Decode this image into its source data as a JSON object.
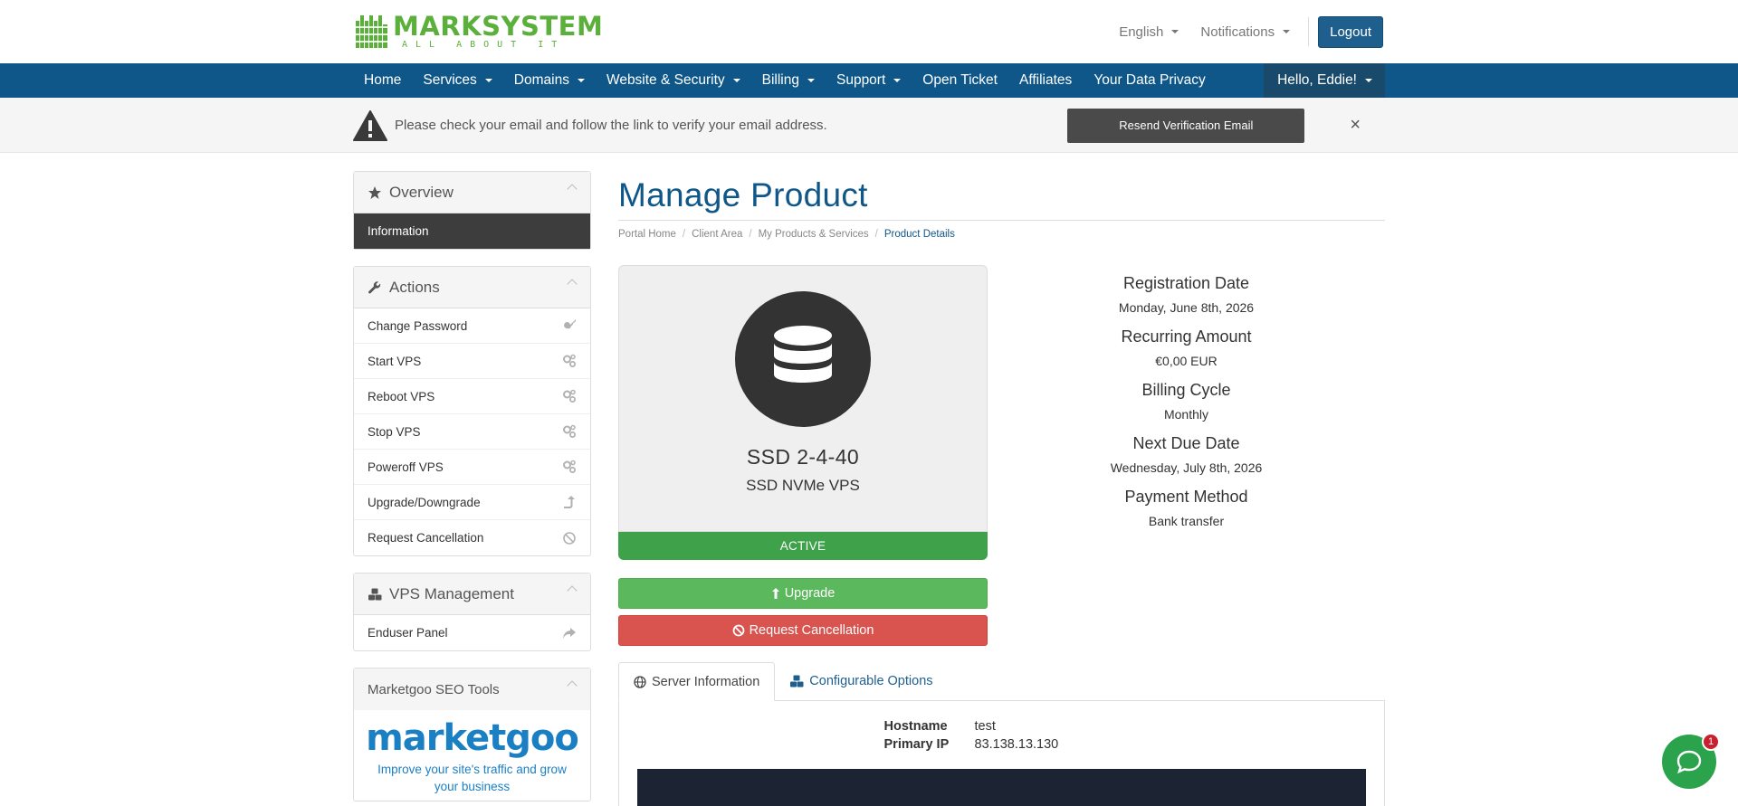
{
  "brand": {
    "name": "MARKSYSTEM",
    "tagline": "ALL ABOUT IT",
    "color": "#5bb03c"
  },
  "header": {
    "language": "English",
    "notifications": "Notifications",
    "logout": "Logout"
  },
  "nav": {
    "items": [
      {
        "label": "Home",
        "dropdown": false
      },
      {
        "label": "Services",
        "dropdown": true
      },
      {
        "label": "Domains",
        "dropdown": true
      },
      {
        "label": "Website & Security",
        "dropdown": true
      },
      {
        "label": "Billing",
        "dropdown": true
      },
      {
        "label": "Support",
        "dropdown": true
      },
      {
        "label": "Open Ticket",
        "dropdown": false
      },
      {
        "label": "Affiliates",
        "dropdown": false
      },
      {
        "label": "Your Data Privacy",
        "dropdown": false
      }
    ],
    "user": "Hello, Eddie!"
  },
  "alert": {
    "message": "Please check your email and follow the link to verify your email address.",
    "button": "Resend Verification Email",
    "close": "×"
  },
  "sidebar": {
    "overview": {
      "title": "Overview",
      "items": [
        {
          "label": "Information"
        }
      ]
    },
    "actions": {
      "title": "Actions",
      "items": [
        {
          "label": "Change Password",
          "icon": "key-icon"
        },
        {
          "label": "Start VPS",
          "icon": "cogs-icon"
        },
        {
          "label": "Reboot VPS",
          "icon": "cogs-icon"
        },
        {
          "label": "Stop VPS",
          "icon": "cogs-icon"
        },
        {
          "label": "Poweroff VPS",
          "icon": "cogs-icon"
        },
        {
          "label": "Upgrade/Downgrade",
          "icon": "level-up-icon"
        },
        {
          "label": "Request Cancellation",
          "icon": "ban-icon"
        }
      ]
    },
    "vps": {
      "title": "VPS Management",
      "items": [
        {
          "label": "Enduser Panel",
          "icon": "share-icon"
        }
      ]
    },
    "seo": {
      "title": "Marketgoo SEO Tools",
      "logo": "marketgoo",
      "text": "Improve your site's traffic and grow your business"
    }
  },
  "main": {
    "title": "Manage Product",
    "breadcrumb": [
      "Portal Home",
      "Client Area",
      "My Products & Services",
      "Product Details"
    ],
    "product": {
      "name": "SSD 2-4-40",
      "group": "SSD NVMe VPS",
      "status": "ACTIVE"
    },
    "buttons": {
      "upgrade": "Upgrade",
      "cancel": "Request Cancellation"
    },
    "info": [
      {
        "label": "Registration Date",
        "value": "Monday, June 8th, 2026"
      },
      {
        "label": "Recurring Amount",
        "value": "€0,00 EUR"
      },
      {
        "label": "Billing Cycle",
        "value": "Monthly"
      },
      {
        "label": "Next Due Date",
        "value": "Wednesday, July 8th, 2026"
      },
      {
        "label": "Payment Method",
        "value": "Bank transfer"
      }
    ],
    "tabs": [
      {
        "label": "Server Information"
      },
      {
        "label": "Configurable Options"
      }
    ],
    "server": [
      {
        "key": "Hostname",
        "value": "test"
      },
      {
        "key": "Primary IP",
        "value": "83.138.13.130"
      }
    ]
  },
  "chat": {
    "badge": "1"
  },
  "colors": {
    "nav": "#0f5788",
    "active": "#3fa24a",
    "danger": "#d9534f",
    "success": "#5cb85c"
  }
}
